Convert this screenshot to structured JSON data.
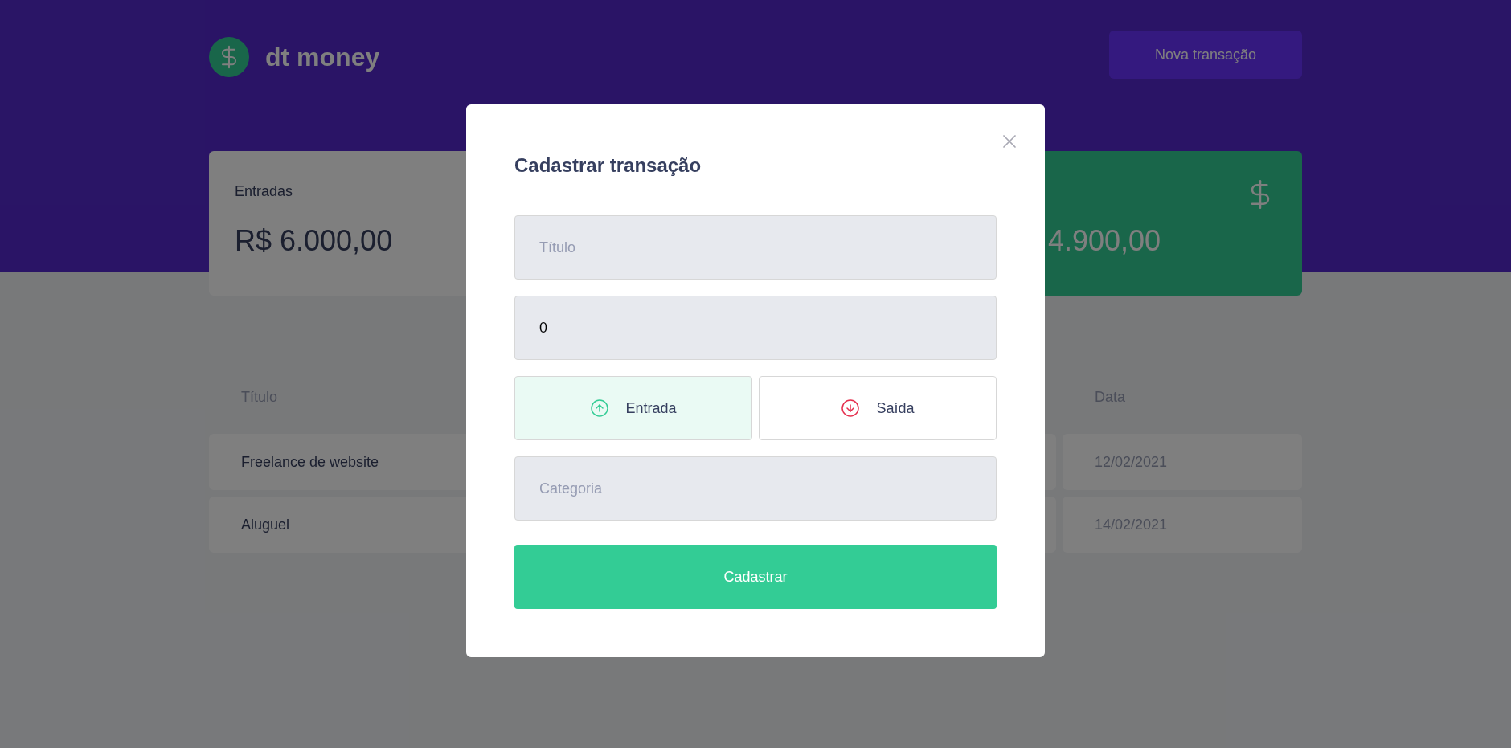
{
  "header": {
    "logo_text": "dt money",
    "new_button": "Nova transação"
  },
  "summary": [
    {
      "kind": "income",
      "title": "Entradas",
      "value": "R$ 6.000,00"
    },
    {
      "kind": "total",
      "value": "4.900,00"
    }
  ],
  "table": {
    "columns": [
      "Título",
      "Data"
    ],
    "rows": [
      {
        "title": "Freelance de website",
        "date": "12/02/2021"
      },
      {
        "title": "Aluguel",
        "date": "14/02/2021"
      }
    ]
  },
  "modal": {
    "title": "Cadastrar transação",
    "fields": [
      {
        "placeholder": "Título"
      },
      {
        "value": "0"
      }
    ],
    "types": [
      {
        "kind": "deposit",
        "label": "Entrada",
        "selected": true
      },
      {
        "kind": "withdraw",
        "label": "Saída",
        "selected": false
      }
    ],
    "category": {
      "placeholder": "Categoria"
    },
    "submit": "Cadastrar"
  }
}
